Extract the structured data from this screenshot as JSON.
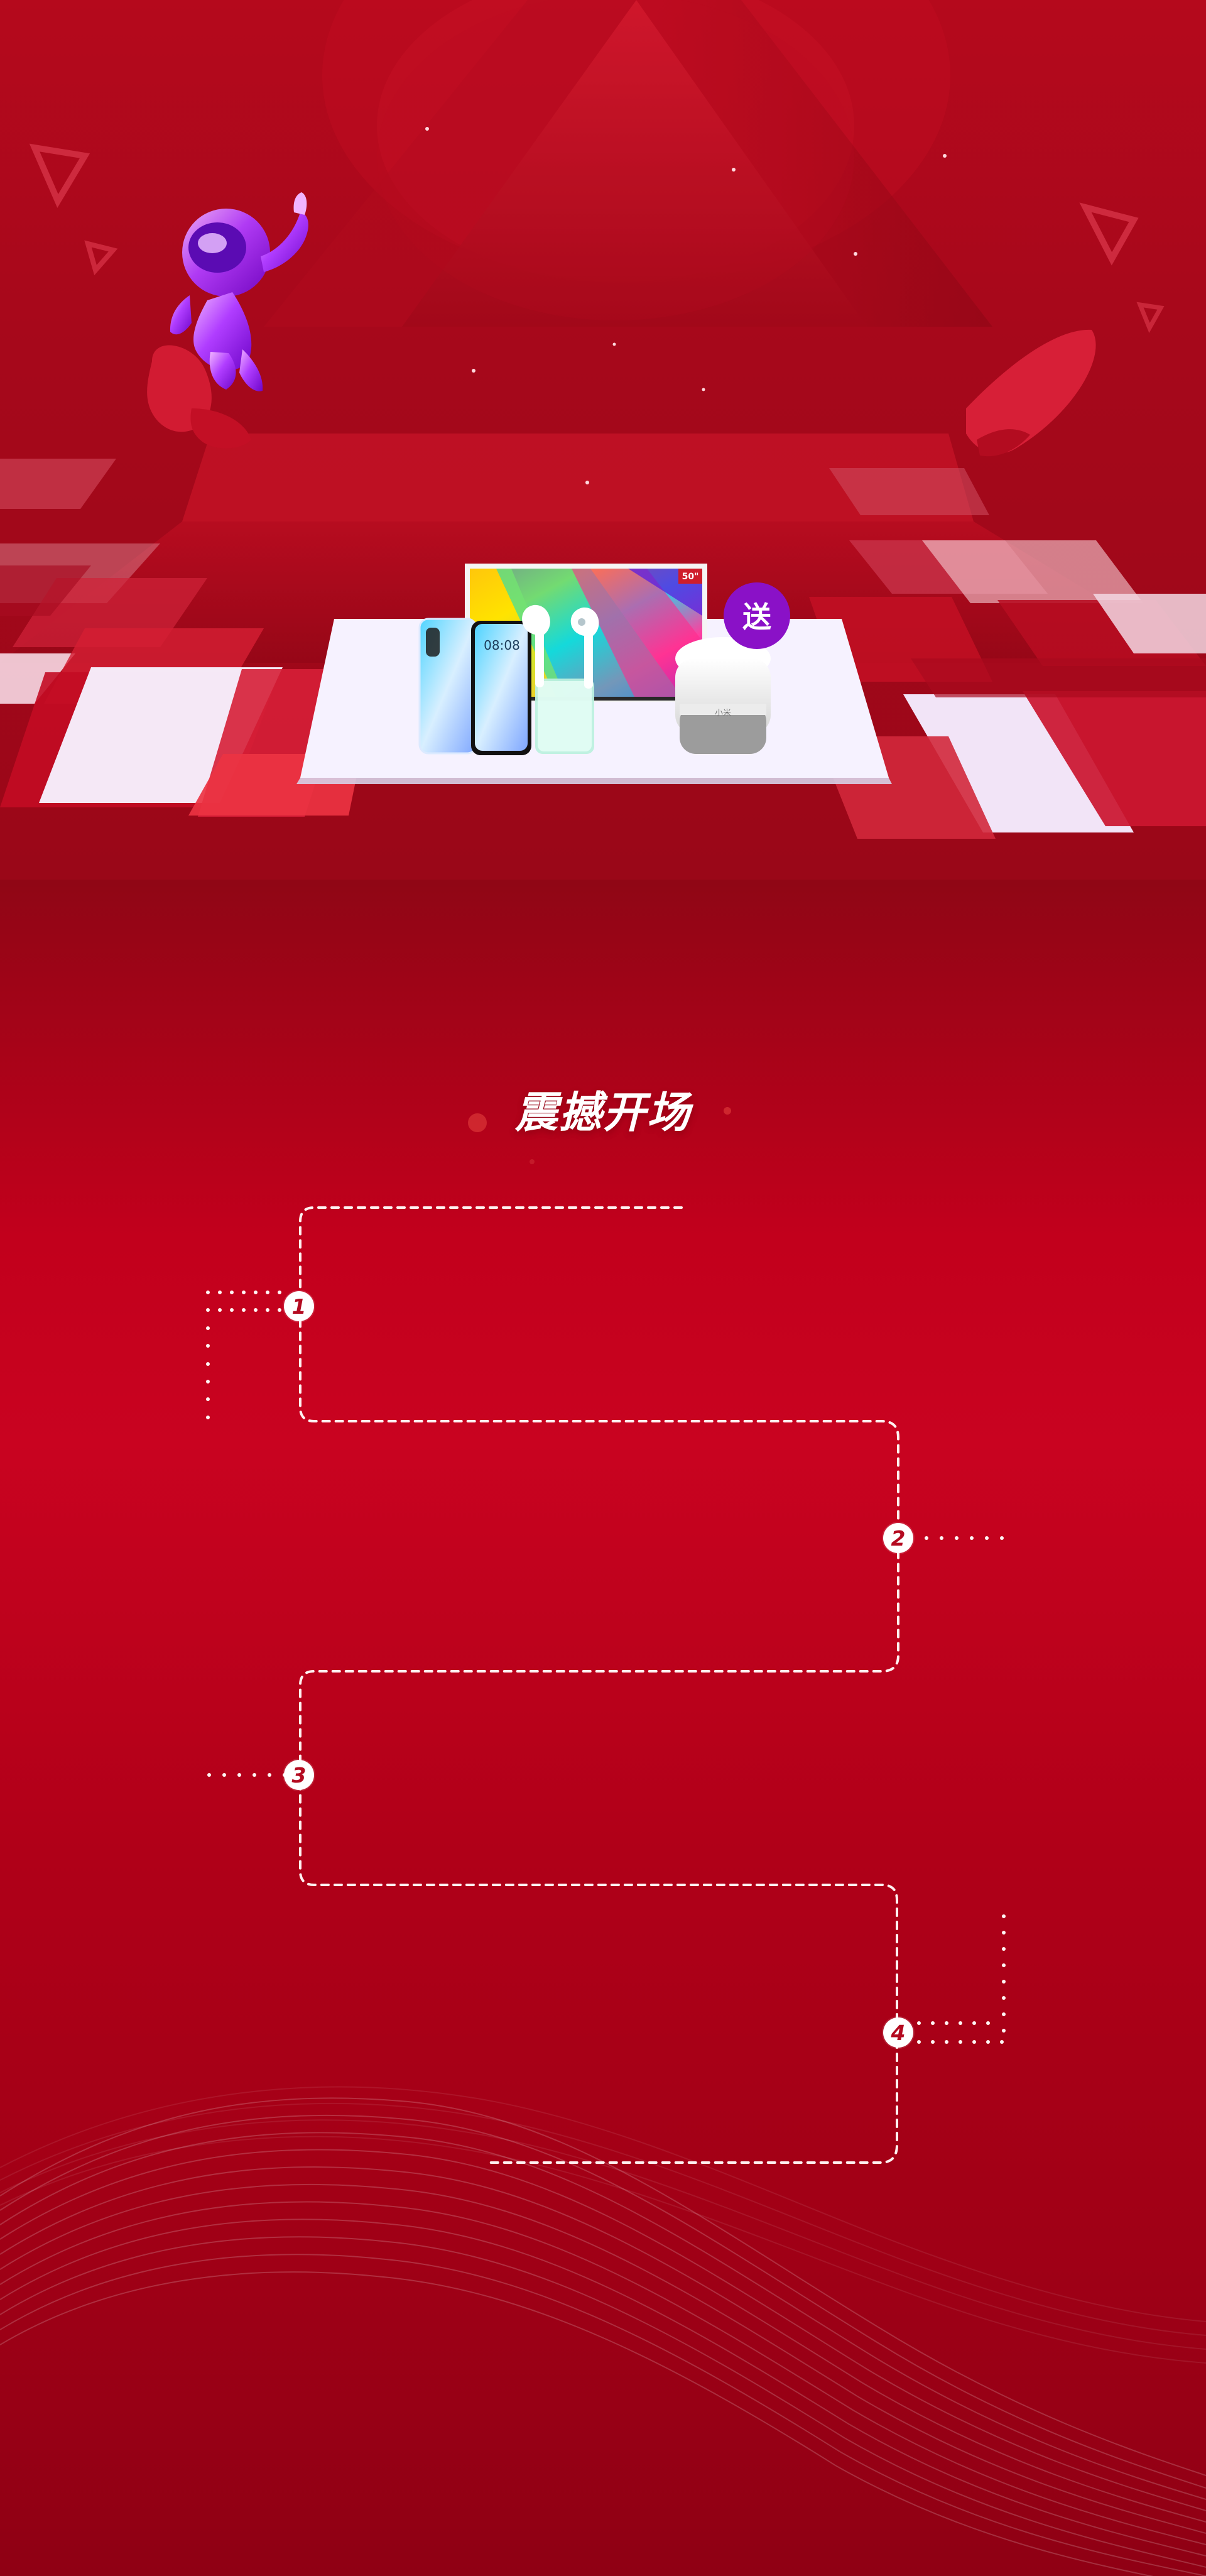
{
  "hero": {
    "tv_badge": "50\"",
    "phone_time": "08:08",
    "speaker_brand": "小米",
    "gift_badge": "送"
  },
  "section": {
    "title": "震撼开场"
  },
  "timeline": {
    "steps": [
      {
        "number": "1"
      },
      {
        "number": "2"
      },
      {
        "number": "3"
      },
      {
        "number": "4"
      }
    ]
  },
  "colors": {
    "primary_red": "#c90320",
    "accent_purple": "#8a11c7",
    "white": "#ffffff"
  },
  "icons": {
    "astronaut": "astronaut-icon",
    "tv": "tv-icon",
    "phone": "phone-icon",
    "earbuds": "earbuds-icon",
    "speaker": "speaker-icon"
  }
}
